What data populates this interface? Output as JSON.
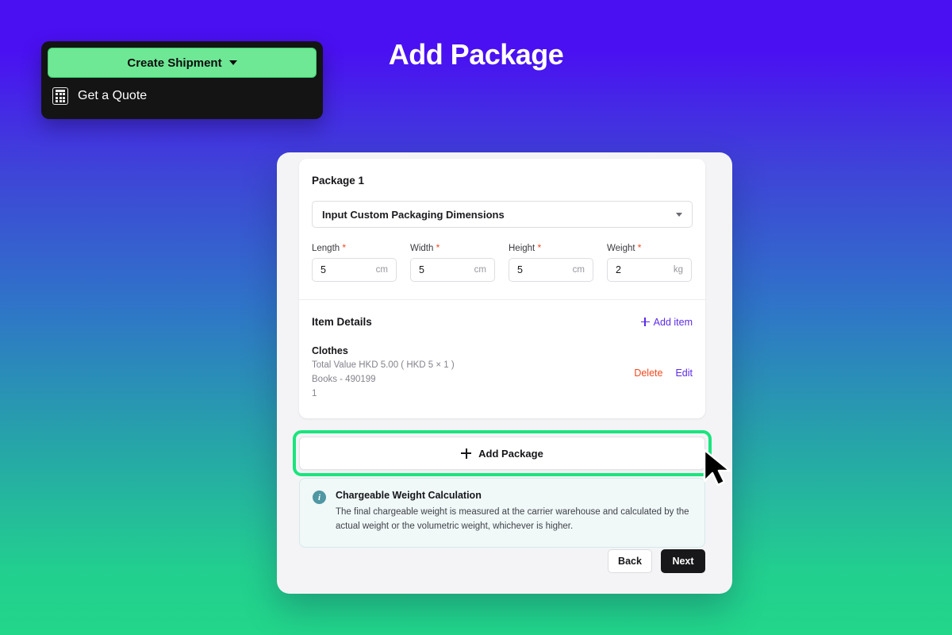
{
  "page": {
    "title": "Add Package"
  },
  "nav_menu": {
    "primary_button": {
      "label": "Create Shipment",
      "icon": "chevron-down-icon"
    },
    "items": [
      {
        "label": "Get a Quote",
        "icon": "calculator-icon"
      }
    ]
  },
  "package_form": {
    "package_title": "Package 1",
    "packaging_select": {
      "value": "Input Custom Packaging Dimensions",
      "icon": "chevron-down-icon"
    },
    "dimension_fields": [
      {
        "label": "Length",
        "required": "*",
        "value": "5",
        "unit": "cm"
      },
      {
        "label": "Width",
        "required": "*",
        "value": "5",
        "unit": "cm"
      },
      {
        "label": "Height",
        "required": "*",
        "value": "5",
        "unit": "cm"
      },
      {
        "label": "Weight",
        "required": "*",
        "value": "2",
        "unit": "kg"
      }
    ]
  },
  "item_details": {
    "heading": "Item Details",
    "add_item_label": "Add item",
    "items": [
      {
        "name": "Clothes",
        "value_line": "Total Value HKD 5.00 ( HKD 5 × 1 )",
        "category_line": "Books - 490199",
        "quantity_line": "1",
        "delete_label": "Delete",
        "edit_label": "Edit"
      }
    ]
  },
  "add_package_button": {
    "label": "Add Package"
  },
  "callout": {
    "title": "Chargeable Weight Calculation",
    "body": "The final chargeable weight is measured at the carrier warehouse and calculated by the actual weight or the volumetric weight, whichever is higher.",
    "icon": "info-icon"
  },
  "footer": {
    "back_label": "Back",
    "next_label": "Next"
  },
  "colors": {
    "background_top": "#4a10f2",
    "background_mid": "#2f74c8",
    "background_bottom": "#22d68a",
    "accent_green": "#6ee895",
    "highlight_green": "#19e57e",
    "link_purple": "#5b2be8",
    "danger_red": "#f1491f",
    "info_teal": "#4f97a3",
    "dark": "#18181b"
  }
}
